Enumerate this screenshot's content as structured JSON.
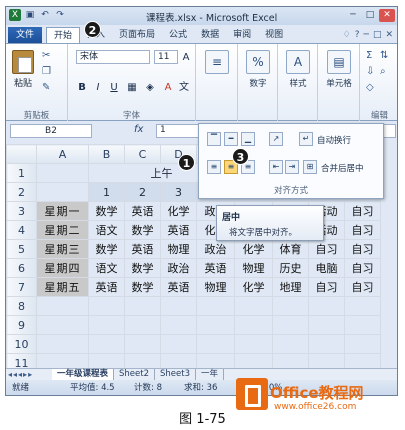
{
  "window": {
    "title": "课程表.xlsx - Microsoft Excel",
    "controls": [
      "─",
      "□",
      "✕"
    ]
  },
  "qat": {
    "icons": [
      "excel-icon",
      "save-icon",
      "undo-icon",
      "redo-icon"
    ]
  },
  "tabs": [
    "文件",
    "开始",
    "插入",
    "页面布局",
    "公式",
    "数据",
    "审阅",
    "视图"
  ],
  "tab_right": [
    "♢",
    "?",
    "─",
    "□",
    "✕"
  ],
  "ribbon": {
    "clipboard": {
      "paste": "粘贴",
      "label": "剪贴板"
    },
    "font": {
      "name": "宋体",
      "size": "11",
      "bold": "B",
      "italic": "I",
      "underline": "U",
      "grow": "A",
      "shrink": "A",
      "label": "字体"
    },
    "alignment": {
      "label": "对齐方式"
    },
    "number": {
      "label": "数字",
      "pct": "%"
    },
    "styles": {
      "label": "样式"
    },
    "cells": {
      "label": "单元格"
    },
    "editing": {
      "label": "编辑",
      "sigma": "Σ",
      "fill": "⇩",
      "clear": "◇"
    }
  },
  "formula_bar": {
    "name_box": "B2",
    "fx": "fx",
    "value": "1"
  },
  "columns": [
    "A",
    "B",
    "C",
    "D",
    "E",
    "F",
    "G",
    "H",
    "I"
  ],
  "rows": [
    {
      "n": "1",
      "cells": [
        "",
        "",
        "上午",
        "",
        "",
        "",
        "",
        "",
        ""
      ]
    },
    {
      "n": "2",
      "cells": [
        "",
        "1",
        "2",
        "3",
        "",
        "",
        "",
        "",
        "8"
      ]
    },
    {
      "n": "3",
      "cells": [
        "星期一",
        "数学",
        "英语",
        "化学",
        "政治",
        "",
        "",
        "活动",
        "自习"
      ]
    },
    {
      "n": "4",
      "cells": [
        "星期二",
        "语文",
        "数学",
        "英语",
        "化学",
        "",
        "",
        "活动",
        "自习"
      ]
    },
    {
      "n": "5",
      "cells": [
        "星期三",
        "数学",
        "英语",
        "物理",
        "政治",
        "化学",
        "体育",
        "自习",
        "自习"
      ]
    },
    {
      "n": "6",
      "cells": [
        "星期四",
        "语文",
        "数学",
        "政治",
        "英语",
        "物理",
        "历史",
        "电脑",
        "自习"
      ]
    },
    {
      "n": "7",
      "cells": [
        "星期五",
        "英语",
        "数学",
        "英语",
        "物理",
        "化学",
        "地理",
        "自习",
        "自习"
      ]
    },
    {
      "n": "8",
      "cells": [
        "",
        "",
        "",
        "",
        "",
        "",
        "",
        "",
        ""
      ]
    },
    {
      "n": "9",
      "cells": [
        "",
        "",
        "",
        "",
        "",
        "",
        "",
        "",
        ""
      ]
    },
    {
      "n": "10",
      "cells": [
        "",
        "",
        "",
        "",
        "",
        "",
        "",
        "",
        ""
      ]
    },
    {
      "n": "11",
      "cells": [
        "",
        "",
        "",
        "",
        "",
        "",
        "",
        "",
        ""
      ]
    }
  ],
  "dropdown": {
    "wrap_text": "自动换行",
    "merge_center": "合并后居中",
    "label": "对齐方式"
  },
  "tooltip": {
    "title": "居中",
    "desc": "将文字居中对齐。"
  },
  "badges": [
    "1",
    "2",
    "3"
  ],
  "sheet_tabs": [
    "一年级课程表",
    "Sheet2",
    "Sheet3",
    "一年"
  ],
  "status": {
    "ready": "就绪",
    "avg": "平均值: 4.5",
    "count": "计数: 8",
    "sum": "求和: 36",
    "zoom": "120%"
  },
  "watermark": {
    "name": "Office教程网",
    "url": "www.office26.com"
  },
  "caption": "图 1-75"
}
